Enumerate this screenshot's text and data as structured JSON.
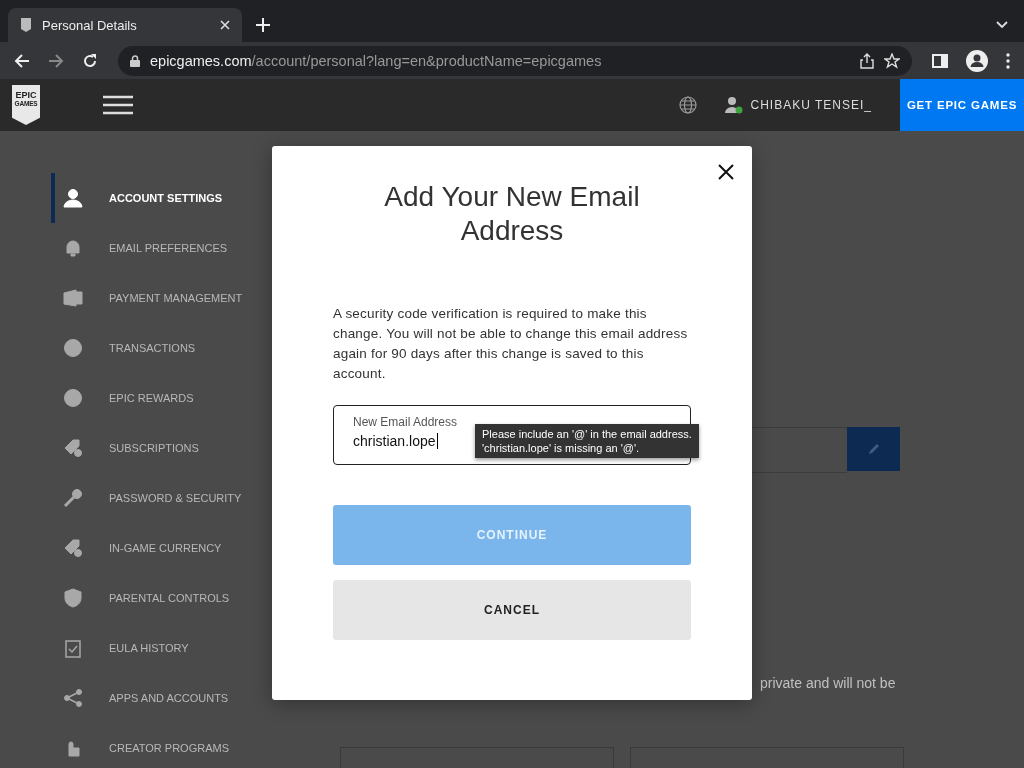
{
  "browser": {
    "tab_title": "Personal Details",
    "url_host": "epicgames.com",
    "url_path": "/account/personal?lang=en&productName=epicgames"
  },
  "nav": {
    "logo_top": "EPIC",
    "logo_bottom": "GAMES",
    "username": "CHIBAKU TENSEI_",
    "online": true,
    "cta": "GET EPIC GAMES"
  },
  "sidebar": {
    "items": [
      {
        "label": "ACCOUNT SETTINGS",
        "selected": true
      },
      {
        "label": "EMAIL PREFERENCES",
        "selected": false
      },
      {
        "label": "PAYMENT MANAGEMENT",
        "selected": false
      },
      {
        "label": "TRANSACTIONS",
        "selected": false
      },
      {
        "label": "EPIC REWARDS",
        "selected": false
      },
      {
        "label": "SUBSCRIPTIONS",
        "selected": false
      },
      {
        "label": "PASSWORD & SECURITY",
        "selected": false
      },
      {
        "label": "IN-GAME CURRENCY",
        "selected": false
      },
      {
        "label": "PARENTAL CONTROLS",
        "selected": false
      },
      {
        "label": "EULA HISTORY",
        "selected": false
      },
      {
        "label": "APPS AND ACCOUNTS",
        "selected": false
      },
      {
        "label": "CREATOR PROGRAMS",
        "selected": false
      }
    ]
  },
  "background": {
    "note": "private and will not be"
  },
  "dialog": {
    "title": "Add Your New Email Address",
    "message": "A security code verification is required to make this change. You will not be able to change this email address again for 90 days after this change is saved to this account.",
    "field": {
      "label": "New Email Address",
      "value": "christian.lope"
    },
    "tooltip": [
      "Please include an '@' in the email address.",
      "'christian.lope' is missing an '@'."
    ],
    "continue": {
      "label": "CONTINUE",
      "disabled": true
    },
    "cancel": "CANCEL"
  }
}
